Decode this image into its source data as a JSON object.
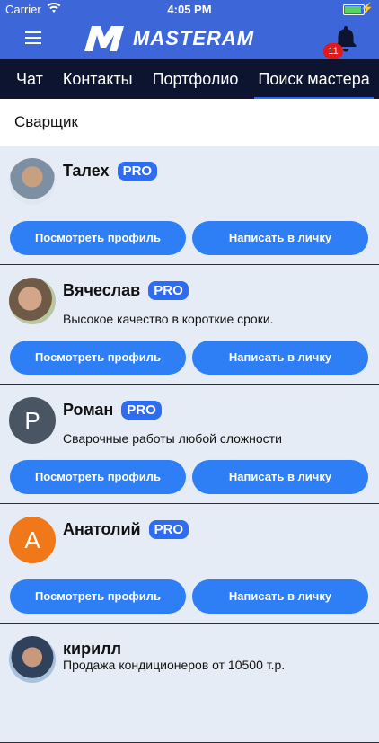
{
  "status_bar": {
    "carrier": "Carrier",
    "time": "4:05 PM"
  },
  "header": {
    "logo_text": "MASTERAM",
    "notification_count": "11"
  },
  "tabs": [
    {
      "label": "Чат",
      "active": false
    },
    {
      "label": "Контакты",
      "active": false
    },
    {
      "label": "Портфолио",
      "active": false
    },
    {
      "label": "Поиск мастера",
      "active": true
    }
  ],
  "search": {
    "query": "Сварщик"
  },
  "colors": {
    "accent": "#2e7ff5",
    "header": "#3d66d8",
    "tabbar": "#0d1430",
    "badge": "#e0191b"
  },
  "masters": [
    {
      "name": "Талех",
      "pro": "PRO",
      "description": "",
      "avatar": "photo",
      "view_label": "Посмотреть профиль",
      "message_label": "Написать в личку"
    },
    {
      "name": "Вячеслав",
      "pro": "PRO",
      "description": "Высокое качество в короткие сроки.",
      "avatar": "photo",
      "view_label": "Посмотреть профиль",
      "message_label": "Написать в личку"
    },
    {
      "name": "Роман",
      "pro": "PRO",
      "description": "Сварочные работы любой сложности",
      "avatar_letter": "Р",
      "avatar_color": "#4a5563",
      "view_label": "Посмотреть профиль",
      "message_label": "Написать в личку"
    },
    {
      "name": "Анатолий",
      "pro": "PRO",
      "description": "",
      "avatar_letter": "А",
      "avatar_color": "#f07818",
      "view_label": "Посмотреть профиль",
      "message_label": "Написать в личку"
    },
    {
      "name": "кирилл",
      "description": "Продажа кондиционеров от 10500 т.р.",
      "avatar": "photo"
    }
  ]
}
